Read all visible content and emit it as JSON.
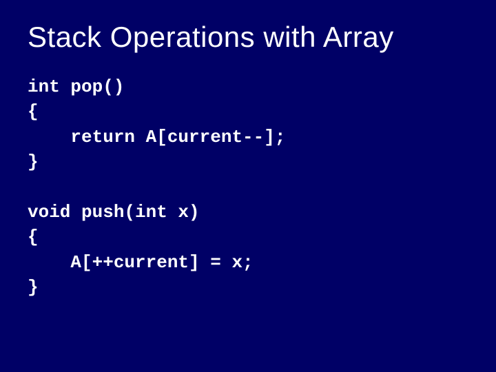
{
  "title": "Stack Operations with Array",
  "code": {
    "line1": "int pop()",
    "line2": "{",
    "line3": "    return A[current--];",
    "line4": "}",
    "line5": "",
    "line6": "void push(int x)",
    "line7": "{",
    "line8": "    A[++current] = x;",
    "line9": "}"
  }
}
